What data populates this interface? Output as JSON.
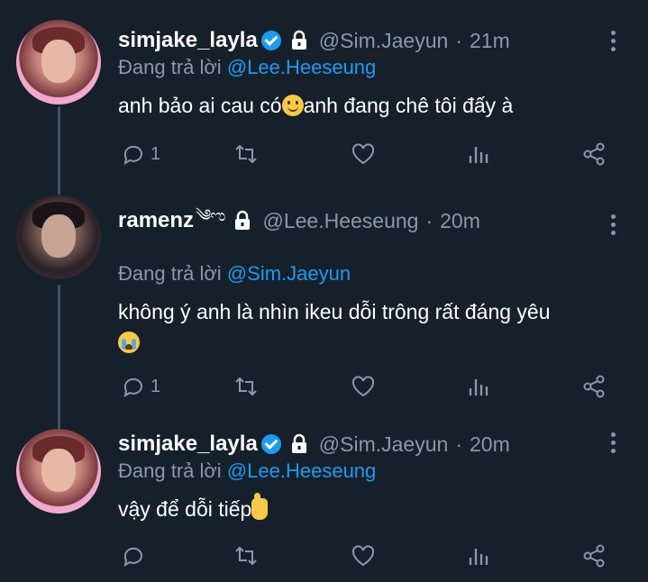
{
  "tweets": [
    {
      "name": "simjake_layla",
      "verified": true,
      "handle": "@Sim.Jaeyun",
      "separator": "·",
      "time": "21m",
      "reply_prefix": "Đang trả lời",
      "reply_mention": "@Lee.Heeseung",
      "text_before": "anh bảo ai cau có",
      "text_after": "anh đang chê tôi đấy à",
      "emoji": "slightly-smiling-face",
      "reply_count": "1"
    },
    {
      "name": "ramenz",
      "name_deco": "༄ಌ",
      "verified": false,
      "handle": "@Lee.Heeseung",
      "separator": "·",
      "time": "20m",
      "reply_prefix": "Đang trả lời",
      "reply_mention": "@Sim.Jaeyun",
      "text_before": "không ý anh là nhìn ikeu dỗi trông rất đáng yêu",
      "text_after": "",
      "emoji": "loudly-crying-face",
      "reply_count": "1"
    },
    {
      "name": "simjake_layla",
      "verified": true,
      "handle": "@Sim.Jaeyun",
      "separator": "·",
      "time": "20m",
      "reply_prefix": "Đang trả lời",
      "reply_mention": "@Lee.Heeseung",
      "text_before": "vậy để dỗi tiếp",
      "text_after": "",
      "emoji": "thumbs-up",
      "reply_count": ""
    }
  ],
  "colors": {
    "background": "#15202b",
    "text": "#ffffff",
    "muted": "#8b98a5",
    "accent": "#1d9bf0",
    "thread_line": "#3d5466"
  },
  "icons": [
    "verified-badge-icon",
    "lock-icon",
    "more-options-icon",
    "reply-icon",
    "retweet-icon",
    "like-icon",
    "analytics-icon",
    "share-icon"
  ]
}
